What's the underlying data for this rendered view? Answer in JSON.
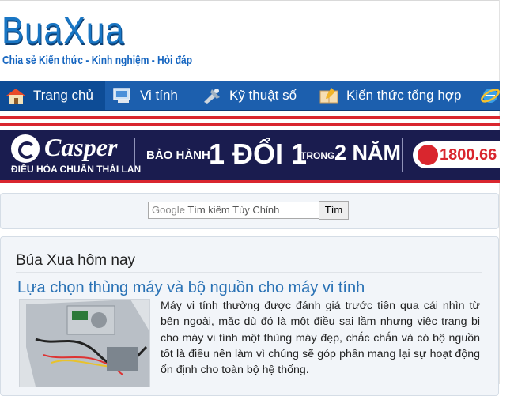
{
  "site": {
    "logo": "BuaXua",
    "tagline": "Chia sẻ Kiến thức - Kinh nghiệm - Hỏi đáp"
  },
  "nav": {
    "items": [
      {
        "label": "Trang chủ",
        "icon": "home-icon"
      },
      {
        "label": "Vi tính",
        "icon": "computer-icon"
      },
      {
        "label": "Kỹ thuật số",
        "icon": "tools-icon"
      },
      {
        "label": "Kiến thức tổng hợp",
        "icon": "knowledge-icon"
      },
      {
        "label": "",
        "icon": "internet-explorer-icon"
      }
    ]
  },
  "banner": {
    "brand": "Casper",
    "brand_sub": "ĐIỀU HÒA CHUẨN THÁI LAN",
    "warranty_label": "BẢO HÀNH",
    "warranty_main": "1 ĐỔI 1",
    "warranty_in": "TRONG",
    "warranty_years": "2 NĂM",
    "hotline": "1800.66"
  },
  "search": {
    "google_label": "Google",
    "placeholder": "Tìm kiếm Tùy Chỉnh",
    "button_label": "Tìm"
  },
  "main": {
    "section_title": "Búa Xua hôm nay",
    "article": {
      "title": "Lựa chọn thùng máy và bộ nguồn cho máy vi tính",
      "excerpt": "Máy vi tính thường được đánh giá trước tiên qua cái nhìn từ bên ngoài, mặc dù đó là một điều sai lầm nhưng việc trang bị cho máy vi tính một thùng máy đẹp, chắc chắn và có bộ nguồn tốt là điều nên làm vì chúng sẽ góp phần mang lại sự hoạt động ổn định cho toàn bộ hệ thống."
    }
  },
  "colors": {
    "nav_bg": "#1c5fae",
    "logo": "#1976c4",
    "link": "#2a72b5",
    "stripe": "#d9262e",
    "banner_bg": "#1a1c4f"
  }
}
